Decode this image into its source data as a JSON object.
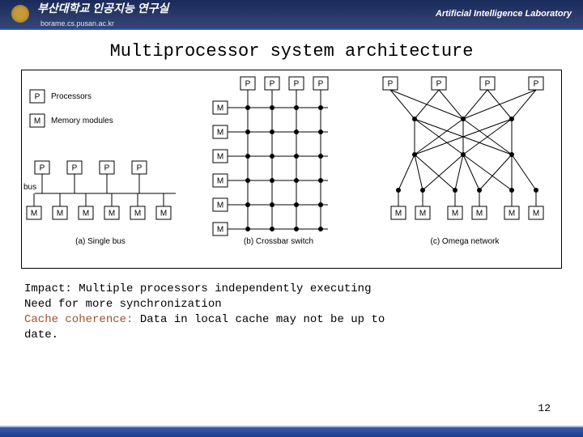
{
  "header": {
    "org": "부산대학교 인공지능 연구실",
    "url": "borame.cs.pusan.ac.kr",
    "lab": "Artificial Intelligence Laboratory"
  },
  "title": "Multiprocessor system architecture",
  "legend": {
    "P": "Processors",
    "M": "Memory modules",
    "bus": "bus"
  },
  "labels": {
    "P": "P",
    "M": "M"
  },
  "captions": {
    "a": "(a) Single bus",
    "b": "(b) Crossbar switch",
    "c": "(c) Omega network"
  },
  "body": {
    "l1": "Impact: Multiple processors independently executing",
    "l2": "Need for more synchronization",
    "l3a": "Cache coherence:",
    "l3b": " Data in local cache may not be up to",
    "l4": "date."
  },
  "page": "12"
}
